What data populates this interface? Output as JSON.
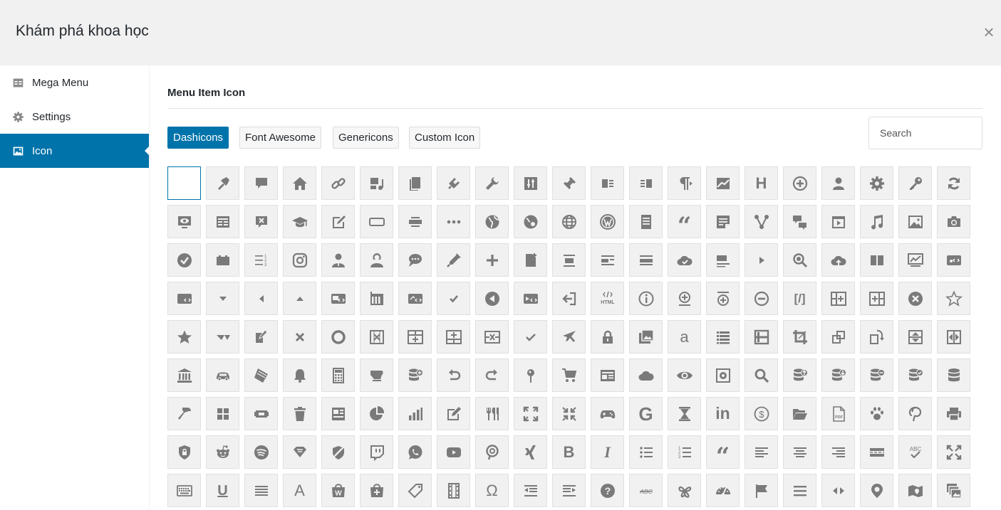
{
  "header": {
    "title": "Khám phá khoa học",
    "close_glyph": "×"
  },
  "sidebar": {
    "items": [
      {
        "label": "Mega Menu",
        "icon": "table-icon",
        "active": false
      },
      {
        "label": "Settings",
        "icon": "gear-icon",
        "active": false
      },
      {
        "label": "Icon",
        "icon": "image-icon",
        "active": true
      }
    ]
  },
  "main": {
    "section_title": "Menu Item Icon",
    "tabs": [
      {
        "label": "Dashicons",
        "active": true
      },
      {
        "label": "Font Awesome",
        "active": false
      },
      {
        "label": "Genericons",
        "active": false
      },
      {
        "label": "Custom Icon",
        "active": false
      }
    ],
    "search_placeholder": "Search"
  },
  "icons": {
    "selected_index": 0,
    "rows": [
      [
        "blank",
        "admin-appearance",
        "admin-comments",
        "admin-home",
        "admin-links",
        "admin-media",
        "admin-page",
        "admin-plugins",
        "admin-tools",
        "admin-settings",
        "admin-post",
        "align-left",
        "align-right",
        "paragraph",
        "analytics",
        "heading",
        "plus-circle",
        "admin-users",
        "gear",
        "key",
        "update"
      ],
      [
        "welcome-view-site",
        "welcome-widgets",
        "dismiss-comment",
        "education",
        "edit-write",
        "button",
        "align-full-width",
        "ellipsis",
        "earth",
        "earth-hole",
        "globe",
        "wordpress",
        "text-page",
        "quote",
        "excerpt",
        "share",
        "comments",
        "video",
        "music",
        "format-image",
        "camera"
      ],
      [
        "yes-circle",
        "battery",
        "ordered-list-alt",
        "instagram",
        "businessman",
        "businesswoman",
        "chat-bubble",
        "color-picker",
        "plus",
        "document-add",
        "align-center",
        "align-text",
        "align-rows",
        "cloud-saved",
        "align-pull",
        "triangle-right",
        "search-zoom",
        "cloud-upload",
        "columns",
        "chart-screen",
        "embed-audio"
      ],
      [
        "embed-generic",
        "arrow-down",
        "arrow-left",
        "arrow-up",
        "embed-photo",
        "calendar",
        "embed-post",
        "small-check",
        "back-circle",
        "embed-video",
        "exit",
        "html",
        "info",
        "insert-after",
        "insert-before",
        "minus-circle",
        "shortcode",
        "table-col-after",
        "table-col-before",
        "no-circle",
        "star-empty"
      ],
      [
        "star-filled",
        "star-half",
        "edit-page",
        "no-alt",
        "marker",
        "table-col-delete",
        "table-row-after",
        "table-row-before",
        "table-row-delete",
        "saved",
        "airplane",
        "lock",
        "image-gallery",
        "amazon",
        "list-view",
        "excerpt-view",
        "crop",
        "image-rotate-left",
        "image-rotate",
        "image-flip-vertical",
        "image-flip-horizontal"
      ],
      [
        "bank",
        "car",
        "coffee",
        "bell",
        "calculator",
        "food",
        "database-add",
        "undo",
        "redo",
        "location",
        "cart",
        "id",
        "cloud",
        "visibility",
        "vault",
        "search",
        "database-export",
        "database-import",
        "database-remove",
        "database-view",
        "database"
      ],
      [
        "hammer",
        "screenoptions",
        "tickets",
        "trash",
        "welcome-widgets-menus",
        "chart-pie",
        "chart-bar",
        "welcome-write-blog",
        "food-utensils",
        "fullscreen",
        "exit-fullscreen",
        "games",
        "google",
        "hourglass",
        "linkedin",
        "money",
        "open-folder",
        "pdf",
        "pets",
        "pinterest",
        "printer"
      ],
      [
        "privacy",
        "reddit",
        "spotify",
        "superhero",
        "hidden",
        "twitch",
        "whatsapp",
        "youtube",
        "pinterest-alt",
        "xing",
        "bold",
        "italic",
        "list-bullet",
        "list-number",
        "quote-alt",
        "align-left-text",
        "align-center-text",
        "align-right-text",
        "insert-more",
        "spellcheck",
        "fullscreen-alt"
      ],
      [
        "keyboard",
        "underline",
        "justify",
        "text-color",
        "woocommerce",
        "shopping-bag",
        "tag",
        "film",
        "omega",
        "outdent",
        "indent",
        "help",
        "strikethrough",
        "art",
        "dashboard",
        "flag",
        "menu",
        "leftright",
        "location-alt",
        "map",
        "image-filter"
      ]
    ]
  }
}
